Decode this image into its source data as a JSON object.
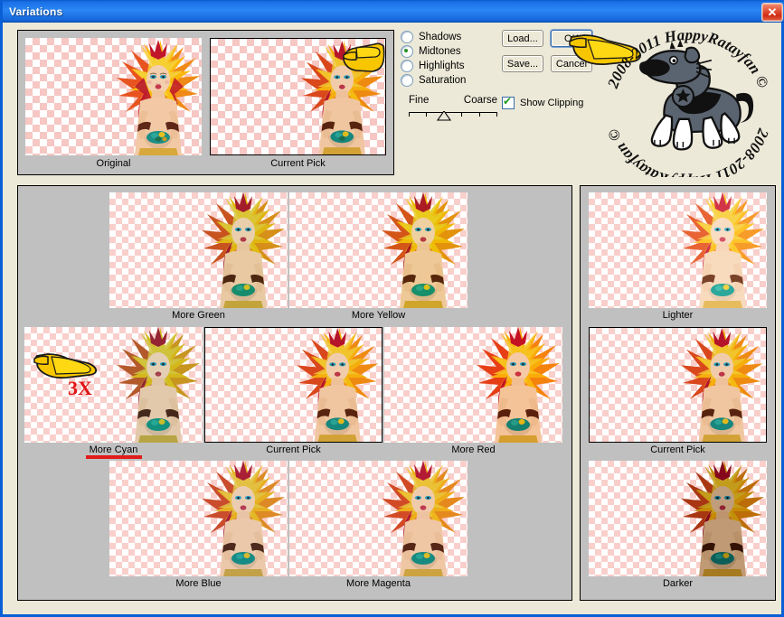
{
  "window": {
    "title": "Variations",
    "close_label": "✕",
    "titlebar_color": "#1b72e8",
    "body_color": "#ece9d8",
    "panel_color": "#c0c0c0"
  },
  "preview": {
    "items": [
      {
        "label": "Original",
        "selected": false
      },
      {
        "label": "Current Pick",
        "selected": true
      }
    ]
  },
  "controls": {
    "radios": [
      {
        "label": "Shadows",
        "selected": false
      },
      {
        "label": "Midtones",
        "selected": true
      },
      {
        "label": "Highlights",
        "selected": false
      },
      {
        "label": "Saturation",
        "selected": false
      }
    ],
    "slider": {
      "min_label": "Fine",
      "max_label": "Coarse",
      "position": 3,
      "ticks": 5
    },
    "buttons": [
      {
        "label": "Load...",
        "default": false
      },
      {
        "label": "OK",
        "default": true
      },
      {
        "label": "Save...",
        "default": false
      },
      {
        "label": "Cancel",
        "default": false
      }
    ],
    "checkbox": {
      "label": "Show Clipping",
      "checked": true
    }
  },
  "grid": {
    "row_top": [
      {
        "label": "More Green",
        "selected": false
      },
      {
        "label": "More Yellow",
        "selected": false
      }
    ],
    "row_middle": [
      {
        "label": "More Cyan",
        "selected": false,
        "underlined": true
      },
      {
        "label": "Current Pick",
        "selected": true
      },
      {
        "label": "More Red",
        "selected": false
      }
    ],
    "row_bottom": [
      {
        "label": "More Blue",
        "selected": false
      },
      {
        "label": "More Magenta",
        "selected": false
      }
    ]
  },
  "side": {
    "items": [
      {
        "label": "Lighter",
        "selected": false
      },
      {
        "label": "Current Pick",
        "selected": true
      },
      {
        "label": "Darker",
        "selected": false
      }
    ]
  },
  "annotations": {
    "multiplier": "3X",
    "multiplier_color": "#e11414",
    "hand_color": "#ffd60a",
    "underline_color": "#e01b1b"
  },
  "watermark": {
    "text_top": "HappyRatayfan © 2008-2011",
    "text_bottom": "HappyRatayfan © 2008-2011",
    "subject": "dog"
  }
}
